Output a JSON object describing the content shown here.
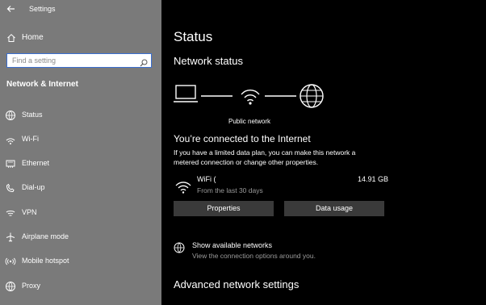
{
  "header": {
    "back_icon": "back-arrow-icon",
    "app_title": "Settings"
  },
  "sidebar": {
    "home": {
      "label": "Home",
      "icon": "home-icon"
    },
    "search": {
      "placeholder": "Find a setting",
      "icon": "search-icon"
    },
    "section_title": "Network & Internet",
    "items": [
      {
        "label": "Status",
        "icon": "status-icon"
      },
      {
        "label": "Wi-Fi",
        "icon": "wifi-icon"
      },
      {
        "label": "Ethernet",
        "icon": "ethernet-icon"
      },
      {
        "label": "Dial-up",
        "icon": "dialup-icon"
      },
      {
        "label": "VPN",
        "icon": "vpn-icon"
      },
      {
        "label": "Airplane mode",
        "icon": "airplane-icon"
      },
      {
        "label": "Mobile hotspot",
        "icon": "hotspot-icon"
      },
      {
        "label": "Proxy",
        "icon": "globe-icon"
      }
    ]
  },
  "main": {
    "page_title": "Status",
    "network_status_heading": "Network status",
    "network_diagram": {
      "network_label": "Public network"
    },
    "connected_heading": "You’re connected to the Internet",
    "data_plan_text": "If you have a limited data plan, you can make this network a metered connection or change other properties.",
    "connection": {
      "name": "WiFi (",
      "period": "From the last 30 days",
      "usage": "14.91 GB"
    },
    "buttons": {
      "properties": "Properties",
      "data_usage": "Data usage"
    },
    "show_networks": {
      "title": "Show available networks",
      "subtitle": "View the connection options around you."
    },
    "advanced_heading": "Advanced network settings"
  },
  "colors": {
    "sidebar_bg": "#7a7a7a",
    "main_bg": "#000000",
    "button_bg": "#3a3a3a",
    "search_border": "#3a6fd1"
  }
}
